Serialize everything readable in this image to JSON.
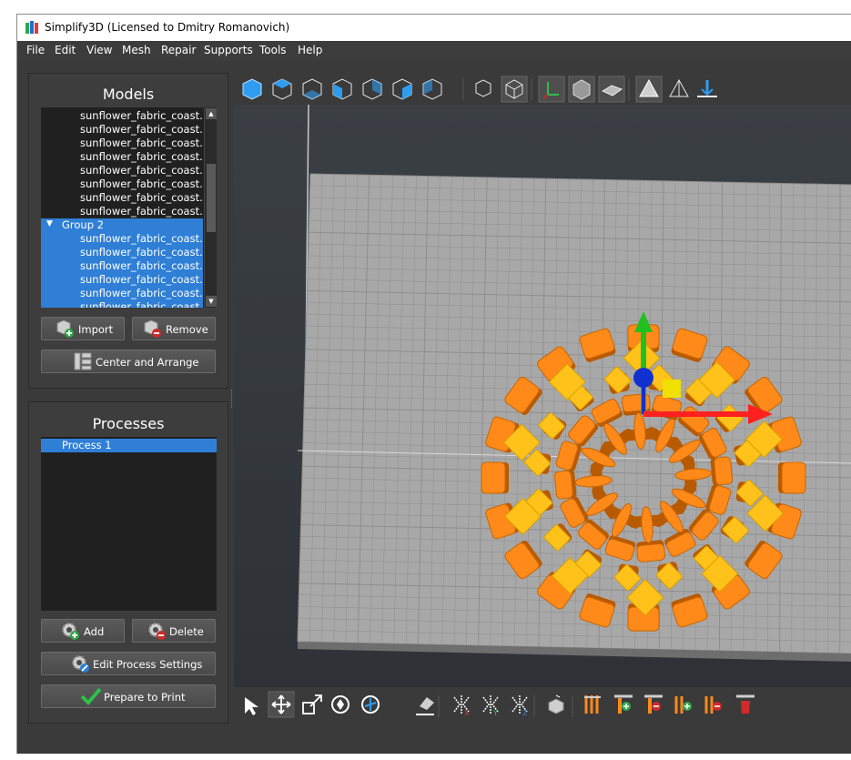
{
  "window": {
    "title": "Simplify3D (Licensed to Dmitry Romanovich)"
  },
  "menu": [
    "File",
    "Edit",
    "View",
    "Mesh",
    "Repair",
    "Supports",
    "Tools",
    "Help"
  ],
  "models": {
    "title": "Models",
    "items": [
      "sunflower_fabric_coast...",
      "sunflower_fabric_coast...",
      "sunflower_fabric_coast...",
      "sunflower_fabric_coast...",
      "sunflower_fabric_coast...",
      "sunflower_fabric_coast...",
      "sunflower_fabric_coast...",
      "sunflower_fabric_coast..."
    ],
    "group_label": "Group 2",
    "group_items": [
      "sunflower_fabric_coast...",
      "sunflower_fabric_coast...",
      "sunflower_fabric_coast...",
      "sunflower_fabric_coast...",
      "sunflower_fabric_coast...",
      "sunflower_fabric_coast..."
    ],
    "import_label": "Import",
    "remove_label": "Remove",
    "center_label": "Center and Arrange"
  },
  "processes": {
    "title": "Processes",
    "items": [
      "Process 1"
    ],
    "add_label": "Add",
    "delete_label": "Delete",
    "edit_label": "Edit Process Settings",
    "prepare_label": "Prepare to Print"
  },
  "colors": {
    "selection": "#2f7fd6",
    "model_orange": "#ff8a1a",
    "model_yellow": "#ffc21a",
    "bed_grid": "#a8a8a8",
    "axis_x": "#ff2020",
    "axis_y": "#20c020",
    "axis_z": "#1030d0"
  },
  "view_toolbar_icons": [
    "view-default-icon",
    "view-top-icon",
    "view-bottom-icon",
    "view-front-icon",
    "view-back-icon",
    "view-left-icon",
    "view-right-icon",
    "ortho-icon",
    "perspective-icon",
    "axes-icon",
    "build-volume-icon",
    "bed-icon",
    "solid-mode-icon",
    "wireframe-mode-icon",
    "ground-icon"
  ],
  "bottom_toolbar_icons": [
    "select-icon",
    "move-icon",
    "scale-icon",
    "rotate-icon",
    "rotate-face-icon",
    "place-surface-icon",
    "mirror-x-icon",
    "mirror-y-icon",
    "mirror-z-icon",
    "object-icon",
    "support-icon",
    "add-support-icon",
    "remove-support-icon",
    "add-custom-support-icon",
    "remove-custom-support-icon",
    "clear-support-icon"
  ]
}
